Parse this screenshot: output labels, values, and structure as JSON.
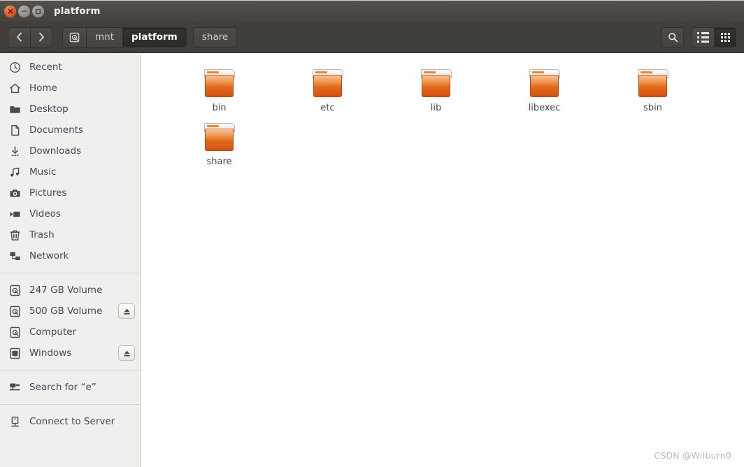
{
  "window": {
    "title": "platform",
    "controls": {
      "close_label": "Close",
      "minimize_label": "Minimize",
      "maximize_label": "Maximize"
    }
  },
  "toolbar": {
    "back_label": "Back",
    "forward_label": "Forward",
    "breadcrumbs": [
      {
        "label": "",
        "icon": "drive-icon",
        "active": false
      },
      {
        "label": "mnt",
        "active": false
      },
      {
        "label": "platform",
        "active": true
      },
      {
        "label": "share",
        "active": false
      }
    ],
    "search_label": "Search",
    "list_view_label": "List view",
    "grid_view_label": "Icon view",
    "active_view": "grid"
  },
  "sidebar": {
    "places": [
      {
        "label": "Recent",
        "icon": "clock-icon"
      },
      {
        "label": "Home",
        "icon": "home-icon"
      },
      {
        "label": "Desktop",
        "icon": "folder-icon"
      },
      {
        "label": "Documents",
        "icon": "document-icon"
      },
      {
        "label": "Downloads",
        "icon": "download-icon"
      },
      {
        "label": "Music",
        "icon": "music-icon"
      },
      {
        "label": "Pictures",
        "icon": "camera-icon"
      },
      {
        "label": "Videos",
        "icon": "video-icon"
      },
      {
        "label": "Trash",
        "icon": "trash-icon"
      },
      {
        "label": "Network",
        "icon": "network-icon"
      }
    ],
    "devices": [
      {
        "label": "247 GB Volume",
        "icon": "drive-icon",
        "eject": false
      },
      {
        "label": "500 GB Volume",
        "icon": "drive-icon",
        "eject": true
      },
      {
        "label": "Computer",
        "icon": "drive-icon",
        "eject": false
      },
      {
        "label": "Windows",
        "icon": "device-icon",
        "eject": true
      }
    ],
    "bookmarks": [
      {
        "label": "Search for “e”",
        "icon": "search-folder-icon"
      }
    ],
    "actions": [
      {
        "label": "Connect to Server",
        "icon": "server-icon"
      }
    ]
  },
  "content": {
    "items": [
      {
        "name": "bin",
        "type": "folder"
      },
      {
        "name": "etc",
        "type": "folder"
      },
      {
        "name": "lib",
        "type": "folder"
      },
      {
        "name": "libexec",
        "type": "folder"
      },
      {
        "name": "sbin",
        "type": "folder"
      },
      {
        "name": "share",
        "type": "folder"
      }
    ]
  },
  "watermark": "CSDN @Wilburn0",
  "colors": {
    "titlebar": "#4c4945",
    "toolbar": "#413f3b",
    "sidebar_bg": "#f0efee",
    "content_bg": "#ffffff",
    "folder_orange": "#e2691d",
    "close_button": "#e0562a",
    "label_text": "#3f4a55"
  }
}
